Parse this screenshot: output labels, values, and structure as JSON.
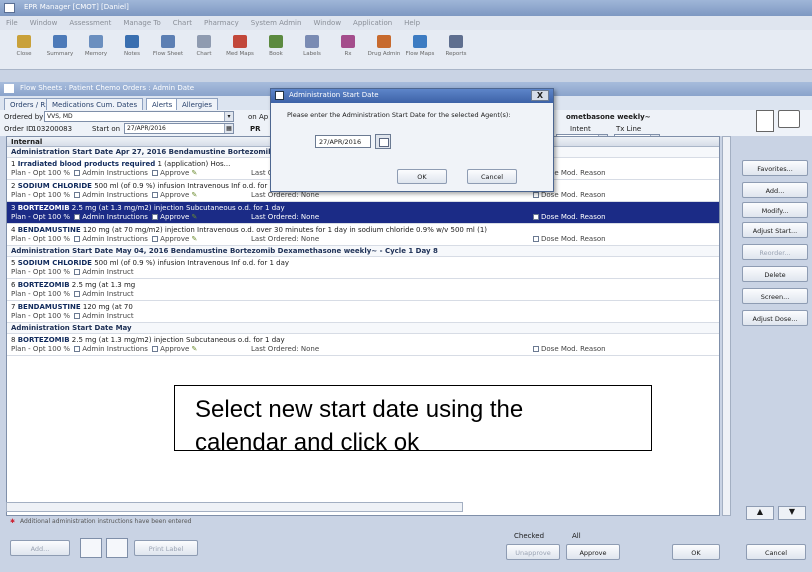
{
  "app": {
    "title": "EPR Manager [CMOT] [Daniel]"
  },
  "menu": [
    "File",
    "Window",
    "Assessment",
    "Manage To",
    "Chart",
    "Pharmacy",
    "System Admin",
    "Window",
    "Application",
    "Help"
  ],
  "toolbar": [
    "Close",
    "Summary",
    "Memory",
    "Notes",
    "Flow Sheet",
    "Chart",
    "Med Maps",
    "Book",
    "Labels",
    "Rx",
    "Drug Admin",
    "Flow Maps",
    "Reports"
  ],
  "child_window": {
    "title": "Flow Sheets : Patient Chemo Orders : Admin Date"
  },
  "tabs": [
    "Orders / Rx",
    "Medications Cum. Dates",
    "Alerts",
    "Allergies"
  ],
  "header": {
    "ordered_by_label": "Ordered by",
    "ordered_by_value": "VVS, MD",
    "on_ap_label": "on Ap",
    "order_id_label": "Order ID",
    "order_id_value": "103200083",
    "start_on_label": "Start on",
    "start_on_value": "27/APR/2016",
    "pr_label": "PR",
    "regimen_title": "ometbasone weekly~",
    "intent_label": "Intent",
    "tx_line_label": "Tx Line"
  },
  "list": {
    "header": "Internal",
    "rows": [
      {
        "type": "group",
        "text": "Administration Start Date Apr 27, 2016        Bendamustine Bortezomib Dexamethasone weekly~ - Cycle 1 Day 1"
      },
      {
        "type": "item",
        "num": "1",
        "drug": "Irradiated blood products required",
        "detail": "1 (application) Hos...",
        "plan": "Plan - Opt   100 %",
        "admin": "Admin Instructions",
        "approve": "Approve",
        "last": "Last Ordered: None",
        "dose": "Dose Mod. Reason",
        "selected": false
      },
      {
        "type": "item",
        "num": "2",
        "drug": "SODIUM CHLORIDE",
        "detail": "500 ml (of 0.9 %) infusion Intravenous Inf o.d. for 1 day",
        "plan": "Plan - Opt   100 %",
        "admin": "Admin Instructions",
        "approve": "Approve",
        "last": "Last Ordered: None",
        "dose": "Dose Mod. Reason",
        "selected": false
      },
      {
        "type": "item",
        "num": "3",
        "drug": "BORTEZOMIB",
        "detail": "2.5 mg (at 1.3 mg/m2) injection Subcutaneous o.d. for 1 day",
        "plan": "Plan - Opt   100 %",
        "admin": "Admin Instructions",
        "approve": "Approve",
        "last": "Last Ordered: None",
        "dose": "Dose Mod. Reason",
        "selected": true
      },
      {
        "type": "item",
        "num": "4",
        "drug": "BENDAMUSTINE",
        "detail": "120 mg (at 70 mg/m2) injection Intravenous o.d. over 30 minutes for 1 day in sodium chloride 0.9% w/v 500 ml (1)",
        "plan": "Plan - Opt   100 %",
        "admin": "Admin Instructions",
        "approve": "Approve",
        "last": "Last Ordered: None",
        "dose": "Dose Mod. Reason",
        "selected": false
      },
      {
        "type": "group",
        "text": "Administration Start Date May 04, 2016        Bendamustine Bortezomib Dexamethasone weekly~ - Cycle 1 Day 8"
      },
      {
        "type": "item",
        "num": "5",
        "drug": "SODIUM CHLORIDE",
        "detail": "500 ml (of 0.9 %) infusion Intravenous Inf o.d. for 1 day",
        "plan": "Plan - Opt   100 %",
        "admin": "Admin Instruct",
        "approve": "",
        "last": "",
        "dose": "",
        "selected": false
      },
      {
        "type": "item",
        "num": "6",
        "drug": "BORTEZOMIB",
        "detail": "2.5 mg (at 1.3 mg",
        "plan": "Plan - Opt   100 %",
        "admin": "Admin Instruct",
        "approve": "",
        "last": "",
        "dose": "",
        "selected": false
      },
      {
        "type": "item",
        "num": "7",
        "drug": "BENDAMUSTINE",
        "detail": "120 mg (at 70",
        "plan": "Plan - Opt   100 %",
        "admin": "Admin Instruct",
        "approve": "",
        "last": "",
        "dose": "",
        "selected": false
      },
      {
        "type": "group",
        "text": "Administration Start Date May"
      },
      {
        "type": "item",
        "num": "8",
        "drug": "BORTEZOMIB",
        "detail": "2.5 mg (at 1.3 mg/m2) injection Subcutaneous o.d. for 1 day",
        "plan": "Plan - Opt   100 %",
        "admin": "Admin Instructions",
        "approve": "Approve",
        "last": "Last Ordered: None",
        "dose": "Dose Mod. Reason",
        "selected": false
      }
    ]
  },
  "note": "Additional administration instructions have been entered",
  "right_panel": [
    "Favorites...",
    "Add...",
    "Modify...",
    "Adjust Start...",
    "Reorder...",
    "Delete",
    "Screen...",
    "Adjust Dose..."
  ],
  "bottom": {
    "add_label": "Add...",
    "print_label": "Print Label",
    "checked_label": "Checked",
    "all_label": "All",
    "unapprove_label": "Unapprove",
    "approve_label": "Approve",
    "ok_label": "OK",
    "cancel_label": "Cancel"
  },
  "dialog": {
    "title": "Administration Start Date",
    "close": "X",
    "prompt": "Please enter the Administration Start Date for the selected Agent(s):",
    "date_value": "27/APR/2016",
    "ok": "OK",
    "cancel": "Cancel"
  },
  "callout": {
    "line1": "Select new start date using the",
    "line2": "calendar and click ok"
  }
}
